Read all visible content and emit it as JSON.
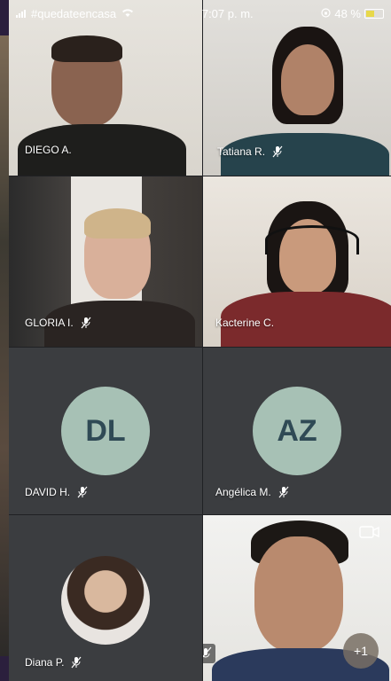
{
  "status_bar": {
    "carrier": "#quedateencasa",
    "time": "7:07 p. m.",
    "battery": "48 %"
  },
  "participants": [
    {
      "name": "DIEGO A.",
      "muted": false
    },
    {
      "name": "Tatiana R.",
      "muted": true
    },
    {
      "name": "GLORIA I.",
      "muted": true
    },
    {
      "name": "Kacterine C.",
      "muted": false
    },
    {
      "name": "DAVID H.",
      "initials": "DL",
      "muted": true
    },
    {
      "name": "Angélica M.",
      "initials": "AZ",
      "muted": true
    },
    {
      "name": "Diana P.",
      "muted": true
    },
    {
      "name": "",
      "muted": true
    }
  ],
  "more_participants_label": "+1",
  "colors": {
    "background": "#202124",
    "avatar_bg": "#a7c1b5",
    "avatar_text": "#2f4a55"
  }
}
